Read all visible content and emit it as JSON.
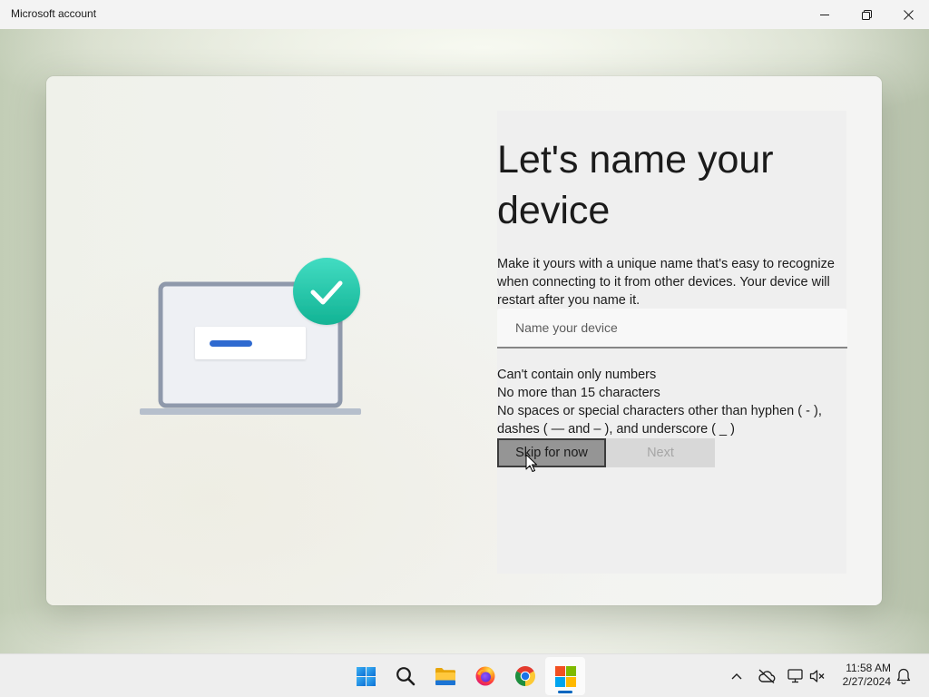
{
  "window": {
    "title": "Microsoft account",
    "controls": [
      "minimize-icon",
      "restore-icon",
      "close-icon"
    ]
  },
  "illustration": {
    "icons": [
      "laptop-icon",
      "checkmark-circle-icon"
    ],
    "colors": {
      "check_circle": "#27cdab",
      "name_bar": "#2f6ad0",
      "laptop_frame": "#8f99ab"
    }
  },
  "setup": {
    "heading": "Let's name your device",
    "description": "Make it yours with a unique name that's easy to recognize when connecting to it from other devices. Your device will restart after you name it.",
    "device_name_input": {
      "placeholder": "Name your device"
    },
    "requirements": [
      "Can't contain only numbers",
      "No more than 15 characters",
      "No spaces or special characters other than hyphen ( - ), dashes ( — and – ), and underscore ( _ )"
    ],
    "buttons": {
      "skip": {
        "label": "Skip for now",
        "hovered": true
      },
      "next": {
        "label": "Next",
        "disabled": true
      }
    }
  },
  "cursor": {
    "icon": "arrow-cursor-icon"
  },
  "taskbar": {
    "apps": [
      {
        "icon": "windows-start-icon"
      },
      {
        "icon": "search-icon"
      },
      {
        "icon": "file-explorer-icon"
      },
      {
        "icon": "firefox-icon"
      },
      {
        "icon": "chrome-icon"
      },
      {
        "icon": "microsoft-logo-icon",
        "active": true
      }
    ],
    "tray_icons": [
      "chevron-up-icon",
      "cloud-off-icon",
      "network-icon",
      "volume-muted-icon",
      "bell-icon"
    ],
    "clock": {
      "time": "11:58 AM",
      "date": "2/27/2024"
    }
  },
  "colors": {
    "accent": "#0067c0",
    "button_hover": "#959595",
    "button_disabled": "#d8d8d8",
    "titlebar": "#f3f3f3"
  }
}
